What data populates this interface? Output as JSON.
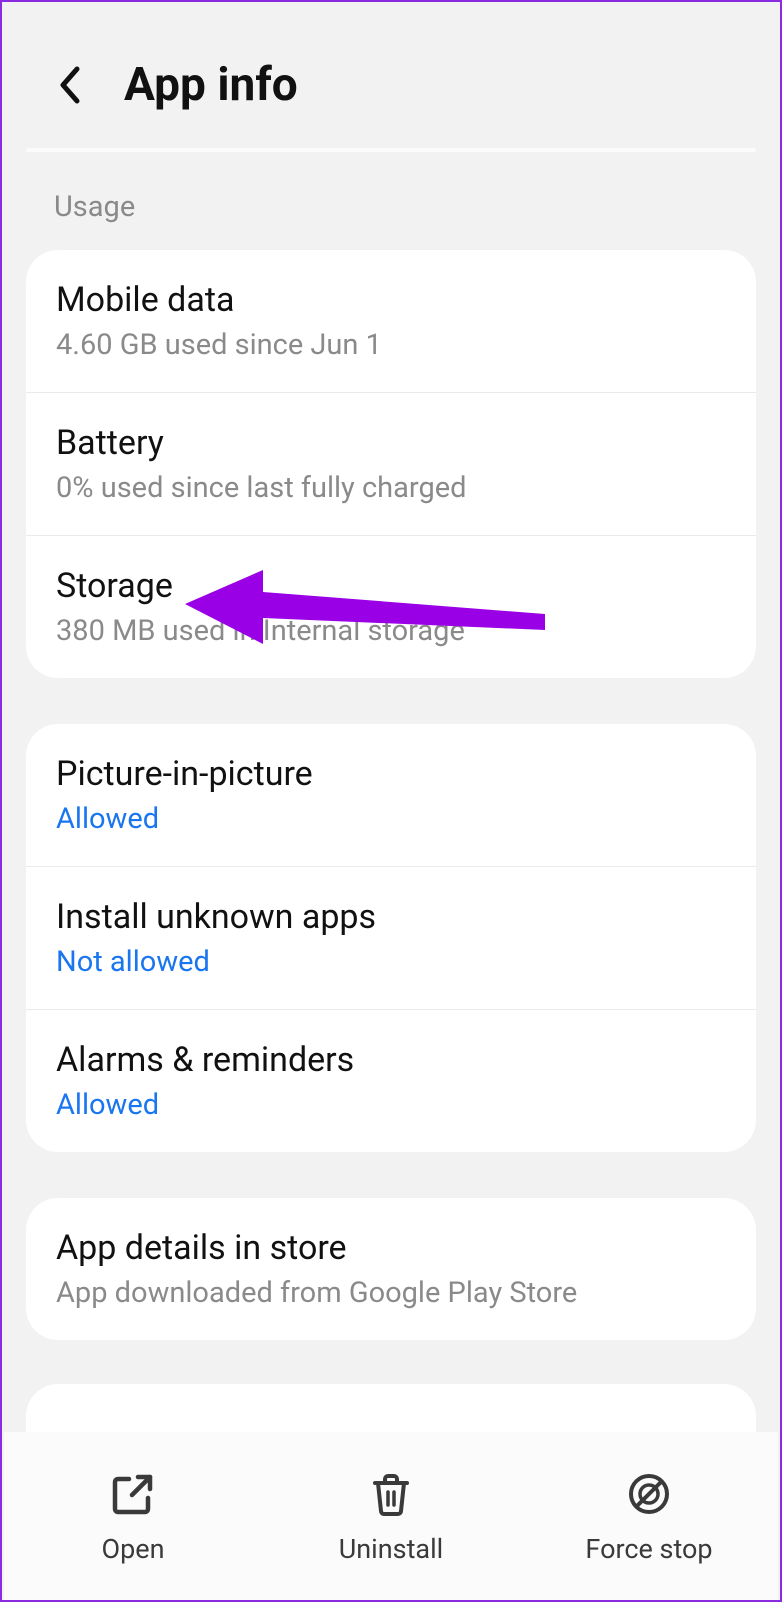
{
  "header": {
    "title": "App info"
  },
  "usage": {
    "label": "Usage",
    "items": [
      {
        "title": "Mobile data",
        "sub": "4.60 GB used since Jun 1",
        "style": "gray"
      },
      {
        "title": "Battery",
        "sub": "0% used since last fully charged",
        "style": "gray"
      },
      {
        "title": "Storage",
        "sub": "380 MB used in Internal storage",
        "style": "gray"
      }
    ]
  },
  "permissions": {
    "items": [
      {
        "title": "Picture-in-picture",
        "sub": "Allowed",
        "style": "blue"
      },
      {
        "title": "Install unknown apps",
        "sub": "Not allowed",
        "style": "blue"
      },
      {
        "title": "Alarms & reminders",
        "sub": "Allowed",
        "style": "blue"
      }
    ]
  },
  "store": {
    "title": "App details in store",
    "sub": "App downloaded from Google Play Store"
  },
  "bottom": {
    "open": "Open",
    "uninstall": "Uninstall",
    "forceStop": "Force stop"
  },
  "annotation": {
    "arrowColor": "#9a00e6"
  }
}
